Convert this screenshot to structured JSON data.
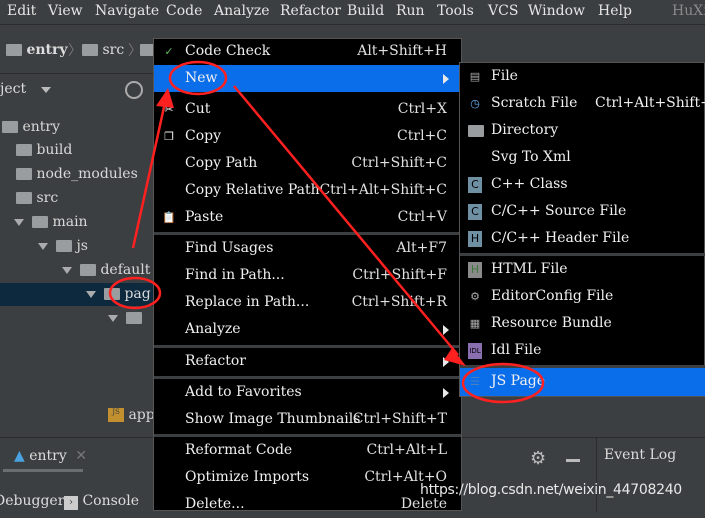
{
  "menubar": {
    "items": [
      "Edit",
      "View",
      "Navigate",
      "Code",
      "Analyze",
      "Refactor",
      "Build",
      "Run",
      "Tools",
      "VCS",
      "Window",
      "Help"
    ],
    "user": "HuXi"
  },
  "breadcrumb": [
    "entry",
    "src"
  ],
  "project_panel": {
    "label": "ject",
    "tree": [
      "entry",
      "build",
      "node_modules",
      "src",
      "main",
      "js",
      "default",
      "pag",
      "app"
    ]
  },
  "context_menu": {
    "items": [
      {
        "label": "Code Check",
        "shortcut": "Alt+Shift+H"
      },
      {
        "label": "New",
        "shortcut": ""
      },
      {
        "label": "Cut",
        "shortcut": "Ctrl+X"
      },
      {
        "label": "Copy",
        "shortcut": "Ctrl+C"
      },
      {
        "label": "Copy Path",
        "shortcut": "Ctrl+Shift+C"
      },
      {
        "label": "Copy Relative Path",
        "shortcut": "Ctrl+Alt+Shift+C"
      },
      {
        "label": "Paste",
        "shortcut": "Ctrl+V"
      },
      {
        "label": "Find Usages",
        "shortcut": "Alt+F7"
      },
      {
        "label": "Find in Path...",
        "shortcut": "Ctrl+Shift+F"
      },
      {
        "label": "Replace in Path...",
        "shortcut": "Ctrl+Shift+R"
      },
      {
        "label": "Analyze",
        "shortcut": ""
      },
      {
        "label": "Refactor",
        "shortcut": ""
      },
      {
        "label": "Add to Favorites",
        "shortcut": ""
      },
      {
        "label": "Show Image Thumbnails",
        "shortcut": "Ctrl+Shift+T"
      },
      {
        "label": "Reformat Code",
        "shortcut": "Ctrl+Alt+L"
      },
      {
        "label": "Optimize Imports",
        "shortcut": "Ctrl+Alt+O"
      },
      {
        "label": "Delete...",
        "shortcut": "Delete"
      }
    ]
  },
  "new_submenu": {
    "items": [
      {
        "label": "File",
        "shortcut": ""
      },
      {
        "label": "Scratch File",
        "shortcut": "Ctrl+Alt+Shift+Ins"
      },
      {
        "label": "Directory",
        "shortcut": ""
      },
      {
        "label": "Svg To Xml",
        "shortcut": ""
      },
      {
        "label": "C++ Class",
        "shortcut": ""
      },
      {
        "label": "C/C++ Source File",
        "shortcut": ""
      },
      {
        "label": "C/C++ Header File",
        "shortcut": ""
      },
      {
        "label": "HTML File",
        "shortcut": ""
      },
      {
        "label": "EditorConfig File",
        "shortcut": ""
      },
      {
        "label": "Resource Bundle",
        "shortcut": ""
      },
      {
        "label": "Idl File",
        "shortcut": ""
      },
      {
        "label": "JS Page",
        "shortcut": ""
      }
    ]
  },
  "bottom": {
    "run_tab": "entry",
    "event_log": "Event Log",
    "debugger": "Debugger",
    "console": "Console"
  },
  "watermark": "https://blog.csdn.net/weixin_44708240",
  "colors": {
    "highlight": "#0a6eea",
    "annotation": "#ff2020",
    "menu_bg": "#000000",
    "ide_bg": "#3c3f41"
  }
}
